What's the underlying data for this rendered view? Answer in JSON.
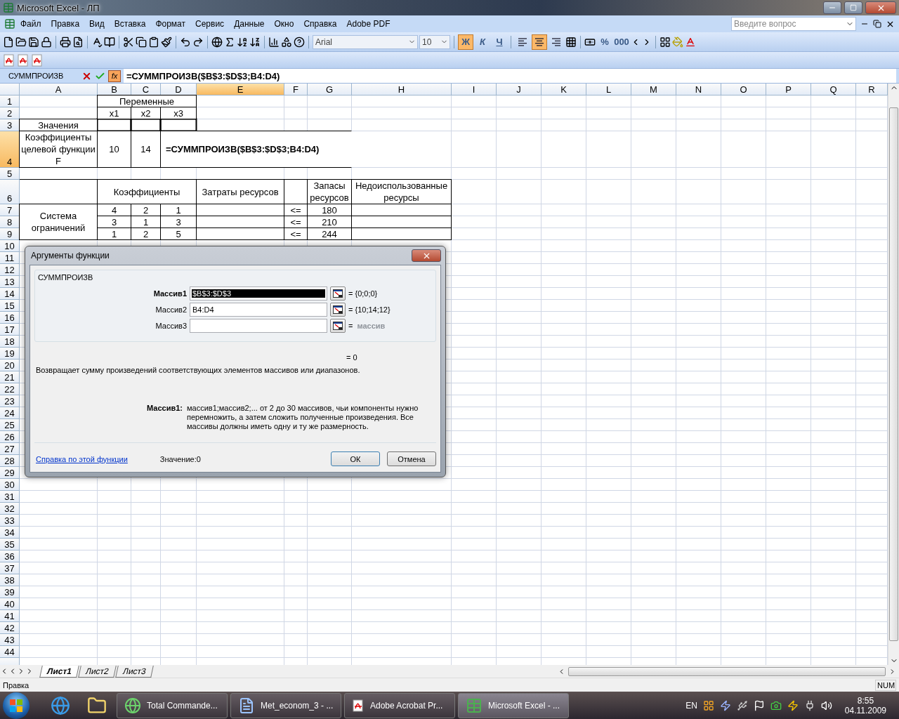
{
  "window": {
    "title": "Microsoft Excel - ЛП"
  },
  "menu": {
    "items": [
      "Файл",
      "Правка",
      "Вид",
      "Вставка",
      "Формат",
      "Сервис",
      "Данные",
      "Окно",
      "Справка",
      "Adobe PDF"
    ],
    "question": {
      "placeholder": "Введите вопрос"
    }
  },
  "formatting": {
    "font": "Arial",
    "size": "10",
    "style_buttons": [
      {
        "label": "Ж",
        "kind": "bold",
        "selected": true
      },
      {
        "label": "К",
        "kind": "italic",
        "selected": false
      },
      {
        "label": "Ч",
        "kind": "underline",
        "selected": false
      }
    ],
    "align_buttons": [
      {
        "kind": "left",
        "selected": false
      },
      {
        "kind": "center",
        "selected": true
      },
      {
        "kind": "right",
        "selected": false
      }
    ],
    "number_buttons": [
      "%",
      "000"
    ]
  },
  "formula_bar": {
    "name_box": "СУММПРОИЗВ",
    "fx": "fx",
    "formula": "=СУММПРОИЗВ($B$3:$D$3;B4:D4)"
  },
  "sheet": {
    "columns": [
      {
        "label": "A",
        "selected": false
      },
      {
        "label": "B",
        "selected": false
      },
      {
        "label": "C",
        "selected": false
      },
      {
        "label": "D",
        "selected": false
      },
      {
        "label": "E",
        "selected": true
      },
      {
        "label": "F",
        "selected": false
      },
      {
        "label": "G",
        "selected": false
      },
      {
        "label": "H",
        "selected": false
      },
      {
        "label": "I",
        "selected": false
      },
      {
        "label": "J",
        "selected": false
      },
      {
        "label": "K",
        "selected": false
      },
      {
        "label": "L",
        "selected": false
      },
      {
        "label": "M",
        "selected": false
      },
      {
        "label": "N",
        "selected": false
      },
      {
        "label": "O",
        "selected": false
      },
      {
        "label": "P",
        "selected": false
      },
      {
        "label": "Q",
        "selected": false
      },
      {
        "label": "R",
        "selected": false
      }
    ],
    "rows": [
      {
        "number": "1",
        "selected": false,
        "cells": [
          {
            "text": "Переменные"
          }
        ]
      },
      {
        "number": "2",
        "selected": false,
        "cells": [
          {
            "text": "x1"
          },
          {
            "text": "x2"
          },
          {
            "text": "x3"
          }
        ]
      },
      {
        "number": "3",
        "selected": false,
        "cells": [
          {
            "text": "Значения"
          }
        ]
      },
      {
        "number": "4",
        "selected": true,
        "cells": [
          {
            "text": "Коэффициенты целевой функции F",
            "bold": false
          },
          {
            "text": "10",
            "bold": false
          },
          {
            "text": "14",
            "bold": false
          },
          {
            "text": "=СУММПРОИЗВ($B$3:$D$3;B4:D4)",
            "bold": true
          }
        ]
      },
      {
        "number": "5",
        "selected": false
      },
      {
        "number": "6",
        "selected": false,
        "cells": [
          {
            "text": "Коэффициенты"
          },
          {
            "text": "Затраты ресурсов"
          },
          {
            "text": "Запасы ресурсов"
          },
          {
            "text": "Недоиспользованные ресурсы"
          }
        ]
      },
      {
        "number": "7",
        "selected": false,
        "cells": [
          {
            "text": "Система ограничений"
          },
          {
            "text": "4"
          },
          {
            "text": "2"
          },
          {
            "text": "1"
          },
          {
            "text": "<="
          },
          {
            "text": "180"
          }
        ]
      },
      {
        "number": "8",
        "selected": false,
        "cells": [
          {
            "text": "3"
          },
          {
            "text": "1"
          },
          {
            "text": "3"
          },
          {
            "text": "<="
          },
          {
            "text": "210"
          }
        ]
      },
      {
        "number": "9",
        "selected": false,
        "cells": [
          {
            "text": "1"
          },
          {
            "text": "2"
          },
          {
            "text": "5"
          },
          {
            "text": "<="
          },
          {
            "text": "244"
          }
        ]
      },
      {
        "number": "10",
        "selected": false
      },
      {
        "number": "11",
        "selected": false
      },
      {
        "number": "12",
        "selected": false
      },
      {
        "number": "13",
        "selected": false
      },
      {
        "number": "14",
        "selected": false
      },
      {
        "number": "15",
        "selected": false
      },
      {
        "number": "16",
        "selected": false
      },
      {
        "number": "17",
        "selected": false
      },
      {
        "number": "18",
        "selected": false
      },
      {
        "number": "19",
        "selected": false
      },
      {
        "number": "20",
        "selected": false
      },
      {
        "number": "21",
        "selected": false
      },
      {
        "number": "22",
        "selected": false
      },
      {
        "number": "23",
        "selected": false
      },
      {
        "number": "24",
        "selected": false
      },
      {
        "number": "25",
        "selected": false
      },
      {
        "number": "26",
        "selected": false
      },
      {
        "number": "27",
        "selected": false
      },
      {
        "number": "28",
        "selected": false
      },
      {
        "number": "29",
        "selected": false
      },
      {
        "number": "30",
        "selected": false
      },
      {
        "number": "31",
        "selected": false
      },
      {
        "number": "32",
        "selected": false
      },
      {
        "number": "33",
        "selected": false
      },
      {
        "number": "34",
        "selected": false
      },
      {
        "number": "35",
        "selected": false
      },
      {
        "number": "36",
        "selected": false
      },
      {
        "number": "37",
        "selected": false
      },
      {
        "number": "38",
        "selected": false
      },
      {
        "number": "39",
        "selected": false
      },
      {
        "number": "40",
        "selected": false
      },
      {
        "number": "41",
        "selected": false
      },
      {
        "number": "42",
        "selected": false
      },
      {
        "number": "43",
        "selected": false
      },
      {
        "number": "44",
        "selected": false
      }
    ]
  },
  "dialog": {
    "title": "Аргументы функции",
    "function": "СУММПРОИЗВ",
    "arguments": [
      {
        "label": "Массив1",
        "value": "$B$3:$D$3",
        "result": "= {0;0;0}",
        "selected": true
      },
      {
        "label": "Массив2",
        "value": "B4:D4",
        "result": "= {10;14;12}",
        "selected": false
      },
      {
        "label": "Массив3",
        "result": "=",
        "hint": "массив",
        "selected": false
      }
    ],
    "result": "= 0",
    "description": "Возвращает сумму произведений соответствующих элементов массивов или диапазонов.",
    "arg_help": {
      "name": "Массив1:",
      "text": "массив1;массив2;... от 2 до 30 массивов, чьи компоненты нужно перемножить, а затем сложить полученные произведения. Все массивы должны иметь одну и ту же размерность."
    },
    "help_link": "Справка по этой функции",
    "value": "Значение:0",
    "buttons": [
      "ОК",
      "Отмена"
    ]
  },
  "sheet_tabs": [
    {
      "label": "Лист1",
      "selected": true
    },
    {
      "label": "Лист2",
      "selected": false
    },
    {
      "label": "Лист3",
      "selected": false
    }
  ],
  "status_bar": {
    "mode": "Правка",
    "indicators": [
      "NUM"
    ]
  },
  "taskbar": {
    "tasks": [
      {
        "label": "Total Commande...",
        "kind": "commander",
        "selected": false
      },
      {
        "label": "Met_econom_3 - ...",
        "kind": "word",
        "selected": false
      },
      {
        "label": "Adobe Acrobat Pr...",
        "kind": "acrobat",
        "selected": false
      },
      {
        "label": "Microsoft Excel - ...",
        "kind": "excel",
        "selected": true
      }
    ],
    "language": "EN",
    "time": "8:55",
    "date": "04.11.2009"
  }
}
